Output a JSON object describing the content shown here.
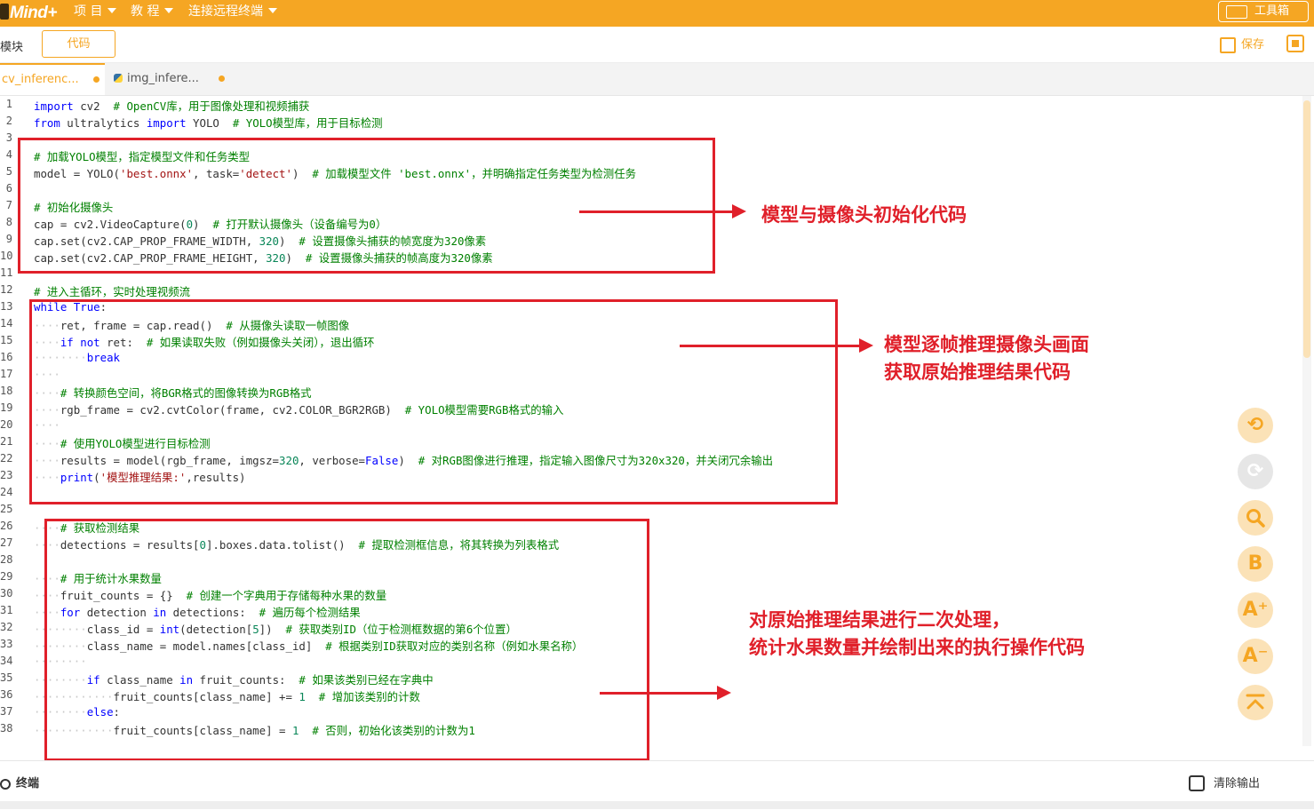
{
  "app": {
    "logo": "Mind+"
  },
  "menu": {
    "project": "项 目",
    "tutorial": "教 程",
    "remote": "连接远程终端",
    "toolbox": "工具箱"
  },
  "toolbar": {
    "module_tab": "模块",
    "code_tab": "代码",
    "save": "保存"
  },
  "file_tabs": [
    {
      "name": "cv_inferenc..."
    },
    {
      "name": "img_infere..."
    }
  ],
  "editor": {
    "line_numbers": [
      "1",
      "2",
      "3",
      "4",
      "5",
      "6",
      "7",
      "8",
      "9",
      "10",
      "11",
      "12",
      "13",
      "14",
      "15",
      "16",
      "17",
      "18",
      "19",
      "20",
      "21",
      "22",
      "23",
      "24",
      "25",
      "26",
      "27",
      "28",
      "29",
      "30",
      "31",
      "32",
      "33",
      "34",
      "35",
      "36",
      "37",
      "38"
    ],
    "code_lines": [
      "import cv2  # OpenCV库，用于图像处理和视频捕获",
      "from ultralytics import YOLO  # YOLO模型库，用于目标检测",
      "",
      "# 加载YOLO模型，指定模型文件和任务类型",
      "model = YOLO('best.onnx', task='detect')  # 加载模型文件 'best.onnx'，并明确指定任务类型为检测任务",
      "",
      "# 初始化摄像头",
      "cap = cv2.VideoCapture(0)  # 打开默认摄像头（设备编号为0）",
      "cap.set(cv2.CAP_PROP_FRAME_WIDTH, 320)  # 设置摄像头捕获的帧宽度为320像素",
      "cap.set(cv2.CAP_PROP_FRAME_HEIGHT, 320)  # 设置摄像头捕获的帧高度为320像素",
      "",
      "# 进入主循环，实时处理视频流",
      "while True:",
      "    ret, frame = cap.read()  # 从摄像头读取一帧图像",
      "    if not ret:  # 如果读取失败（例如摄像头关闭），退出循环",
      "        break",
      "    ",
      "    # 转换颜色空间，将BGR格式的图像转换为RGB格式",
      "    rgb_frame = cv2.cvtColor(frame, cv2.COLOR_BGR2RGB)  # YOLO模型需要RGB格式的输入",
      "    ",
      "    # 使用YOLO模型进行目标检测",
      "    results = model(rgb_frame, imgsz=320, verbose=False)  # 对RGB图像进行推理，指定输入图像尺寸为320x320，并关闭冗余输出",
      "    print('模型推理结果:',results)",
      "",
      "",
      "    # 获取检测结果",
      "    detections = results[0].boxes.data.tolist()  # 提取检测框信息，将其转换为列表格式",
      "",
      "    # 用于统计水果数量",
      "    fruit_counts = {}  # 创建一个字典用于存储每种水果的数量",
      "    for detection in detections:  # 遍历每个检测结果",
      "        class_id = int(detection[5])  # 获取类别ID（位于检测框数据的第6个位置）",
      "        class_name = model.names[class_id]  # 根据类别ID获取对应的类别名称（例如水果名称）",
      "        ",
      "        if class_name in fruit_counts:  # 如果该类别已经在字典中",
      "            fruit_counts[class_name] += 1  # 增加该类别的计数",
      "        else:",
      "            fruit_counts[class_name] = 1  # 否则，初始化该类别的计数为1"
    ]
  },
  "annotations": {
    "a1": "模型与摄像头初始化代码",
    "a2_line1": "模型逐帧推理摄像头画面",
    "a2_line2": "获取原始推理结果代码",
    "a3_line1": "对原始推理结果进行二次处理，",
    "a3_line2": "统计水果数量并绘制出来的执行操作代码"
  },
  "side_buttons": [
    {
      "icon": "undo-icon"
    },
    {
      "icon": "redo-icon"
    },
    {
      "icon": "search-icon"
    },
    {
      "icon": "format-icon",
      "glyph": "B"
    },
    {
      "icon": "font-increase-icon",
      "glyph": "A⁺"
    },
    {
      "icon": "font-decrease-icon",
      "glyph": "A⁻"
    },
    {
      "icon": "scroll-top-icon"
    }
  ],
  "bottom": {
    "terminal": "终端",
    "clear_output": "清除输出"
  },
  "colors": {
    "accent": "#f5a623",
    "annotation": "#e0202a",
    "keyword": "#0000ff",
    "comment": "#008000",
    "string": "#a31515"
  }
}
